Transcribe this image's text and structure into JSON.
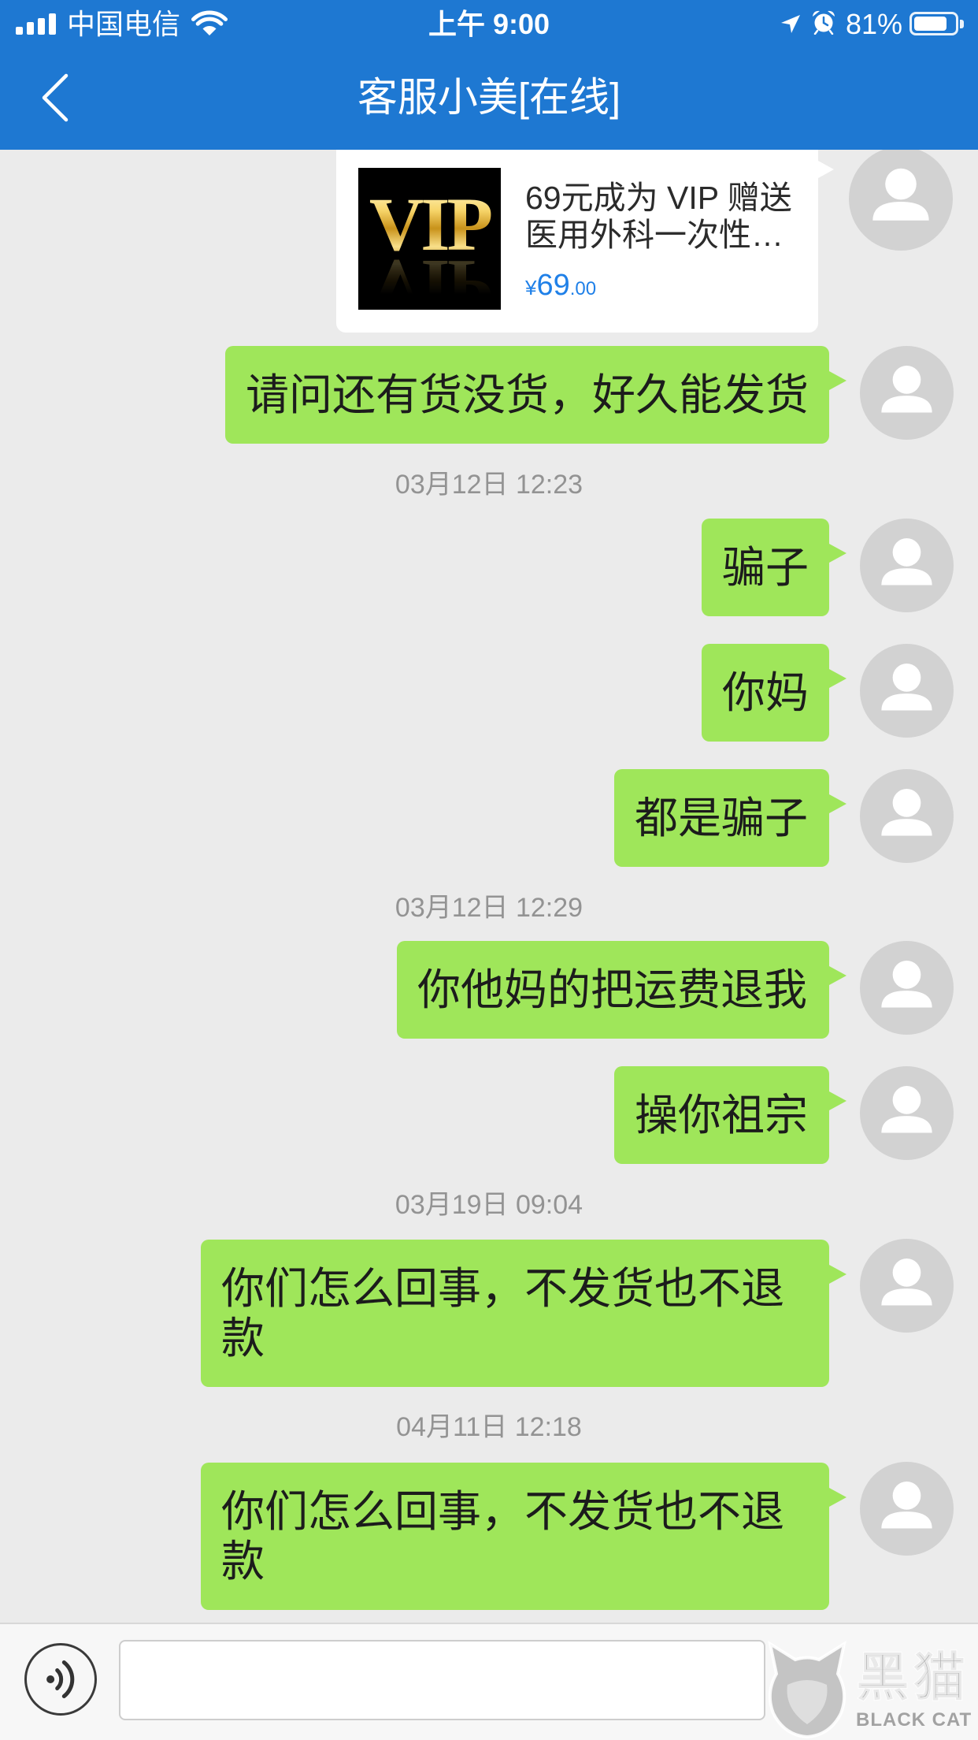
{
  "status_bar": {
    "carrier": "中国电信",
    "time": "上午 9:00",
    "battery_text": "81%",
    "battery_level": 0.81,
    "icons": {
      "signal": "signal-icon",
      "wifi": "wifi-icon",
      "location": "location-arrow-icon",
      "alarm": "alarm-clock-icon",
      "battery": "battery-icon"
    }
  },
  "nav": {
    "title": "客服小美[在线]",
    "back_icon": "chevron-left-icon"
  },
  "chat": {
    "avatar_icon": "person-icon",
    "product_card": {
      "image_text": "VIP",
      "title_line1": "69元成为 VIP 赠送",
      "title_line2": "医用外科一次性…",
      "price_currency": "¥",
      "price_integer": "69",
      "price_decimal": ".00"
    },
    "items": [
      {
        "text": "请问还有货没货，好久能发货"
      },
      {
        "timestamp": "03月12日 12:23"
      },
      {
        "text": "骗子"
      },
      {
        "text": "你妈"
      },
      {
        "text": "都是骗子"
      },
      {
        "timestamp": "03月12日 12:29"
      },
      {
        "text": "你他妈的把运费退我"
      },
      {
        "text": "操你祖宗"
      },
      {
        "timestamp": "03月19日 09:04"
      },
      {
        "text": "你们怎么回事，不发货也不退款"
      },
      {
        "timestamp": "04月11日 12:18"
      },
      {
        "text": "你们怎么回事，不发货也不退款"
      }
    ]
  },
  "input_bar": {
    "voice_icon": "voice-icon"
  },
  "watermark": {
    "logo_icon": "cat-head-icon",
    "brand_cn": "黑猫",
    "brand_en": "BLACK CAT"
  },
  "colors": {
    "nav_bar": "#1e78d2",
    "chat_background": "#ebebeb",
    "sent_bubble": "#9fe65a",
    "price": "#1f80e8",
    "timestamp_text": "#939393",
    "avatar": "#d2d2d2"
  }
}
